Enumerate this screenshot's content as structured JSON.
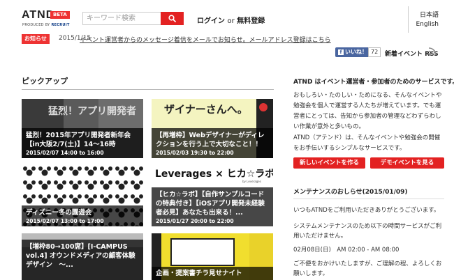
{
  "header": {
    "logo": "ATND",
    "beta": "BETA",
    "byline_produced": "PRODUCED BY",
    "byline_brand": "RECRUIT",
    "search_placeholder": "キーワード検索",
    "login": "ログイン",
    "or": "or",
    "register": "無料登録",
    "lang_ja": "日本語",
    "lang_en": "English"
  },
  "notice": {
    "badge": "お知らせ",
    "date": "2015/1/15",
    "text": "イベント運営者からのメッセージ着信をメールでお知らせ。メールアドレス登録はこちら"
  },
  "social": {
    "like_label": "いいね！",
    "like_count": "72",
    "rss_label": "新着イベント RSS"
  },
  "pickup": {
    "title": "ピックアップ",
    "cards": [
      {
        "title": "猛烈！2015年アプリ開発者新年会【in大阪2/7(土)】14〜16時",
        "time": "2015/02/07 14:00 to 16:00",
        "image_text": "猛烈！アプリ開発者"
      },
      {
        "title": "【再増枠】Webデザイナーがディレクションを行う上で大切なこと！！",
        "time": "2015/02/03 19:30 to 22:00",
        "image_text": "ザイナーさんへ。"
      },
      {
        "title": "ディズニー冬の園遊会",
        "time": "2015/02/07 13:00 to 17:00"
      },
      {
        "title": "【ヒカ☆ラボ】【自作サンプルコードの特典付き】【iOSアプリ開発未経験者必見】あなたも出来る！...",
        "time": "2015/01/27 20:00 to 22:00",
        "image_text": "Leverages × ヒカ☆ラボ",
        "image_sub": "by Leverages"
      },
      {
        "title": "【増枠80→100席】[I-CAMPUS vol.4] オウンドメディアの顧客体験デザイン　〜...",
        "time": ""
      },
      {
        "title": "企画・提案書チラ見せナイト",
        "time": ""
      }
    ]
  },
  "about": {
    "title": "ATND はイベント運営者・参加者のためのサービスです。",
    "p1": "おもしろい・たのしい・ためになる、そんなイベントや勉強会を個人で運営する人たちが増えています。でも運営者にとっては、告知から参加者の管理などわずらわしい作業が意外と多いもの。",
    "p2": "ATND（アテンド）は、そんなイベントや勉強会の開催をお手伝いするシンプルなサービスです。",
    "btn_new": "新しいイベントを作る",
    "btn_search": "デモイベントを見る"
  },
  "maintenance": {
    "title": "メンテナンスのおしらせ(2015/01/09)",
    "l1": "いつもATNDをご利用いただきありがとうございます。",
    "l2": "システムメンテナンスのため以下の時間サービスがご利用いただけません。",
    "l3": "02月08日(日)　AM 02:00 - AM 08:00",
    "l4": "ご不便をおかけいたしますが、ご理解の程、よろしくお願いします。"
  },
  "colors": {
    "accent": "#e32222",
    "facebook": "#4a66a0"
  }
}
